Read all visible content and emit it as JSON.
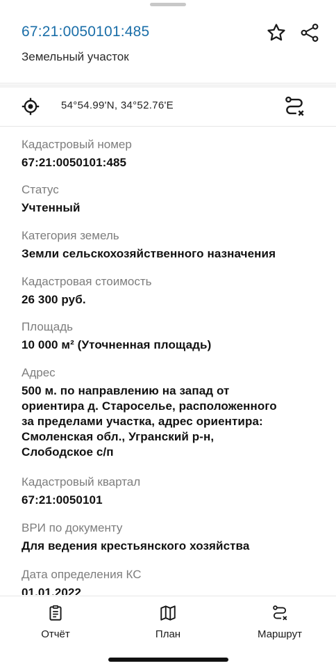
{
  "header": {
    "cadastral_number": "67:21:0050101:485",
    "subtitle": "Земельный участок"
  },
  "location": {
    "coordinates": "54°54.99'N, 34°52.76'E"
  },
  "fields": [
    {
      "label": "Кадастровый номер",
      "value": "67:21:0050101:485"
    },
    {
      "label": "Статус",
      "value": "Учтенный"
    },
    {
      "label": "Категория земель",
      "value": "Земли сельскохозяйственного назначения"
    },
    {
      "label": "Кадастровая стоимость",
      "value": "26 300 руб."
    },
    {
      "label": "Площадь",
      "value": "10 000 м² (Уточненная площадь)"
    },
    {
      "label": "Адрес",
      "value_lines": [
        "500 м. по направлению на запад от",
        "ориентира д. Староселье, расположенного",
        "за пределами участка, адрес ориентира:",
        "Смоленская обл., Угранский р-н,",
        "Слободское с/п"
      ]
    },
    {
      "label": "Кадастровый квартал",
      "value": "67:21:0050101"
    },
    {
      "label": "ВРИ по документу",
      "value": "Для ведения крестьянского хозяйства"
    },
    {
      "label": "Дата определения КС",
      "value": "01.01.2022"
    }
  ],
  "bottom_nav": {
    "report": "Отчёт",
    "plan": "План",
    "route": "Маршрут"
  },
  "colors": {
    "accent": "#1a6ea8",
    "label": "#7d7d7d",
    "divider": "#e6e6e6"
  }
}
